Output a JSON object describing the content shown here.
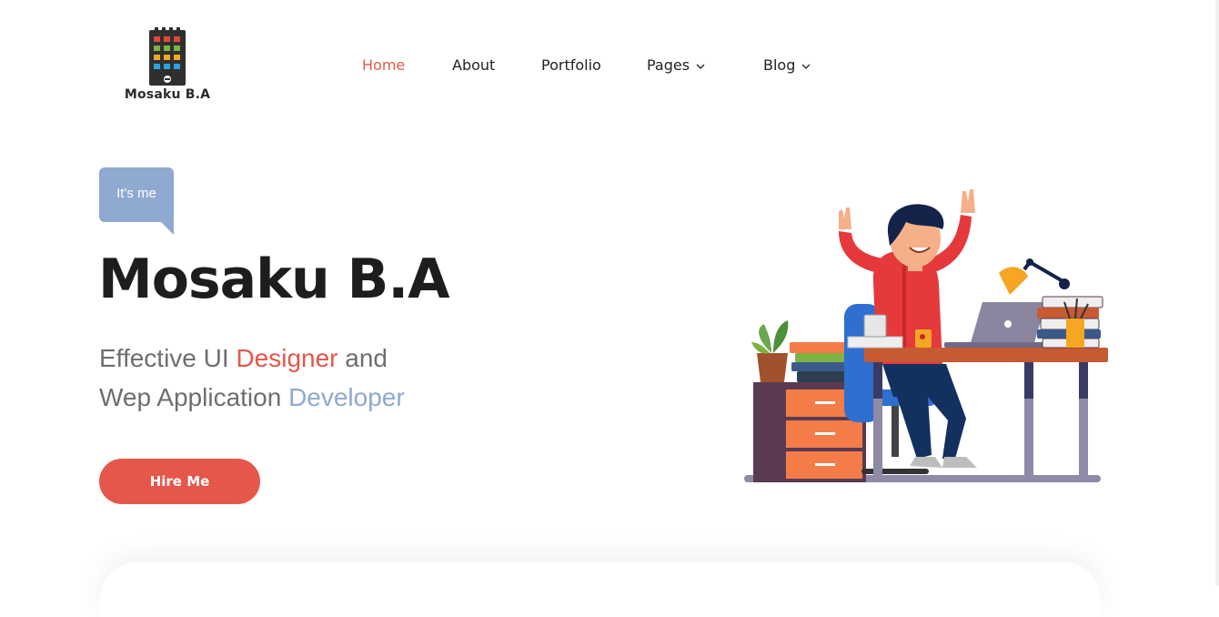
{
  "brand": {
    "name": "Mosaku B.A",
    "icon": "building-logo-icon"
  },
  "nav": {
    "items": [
      {
        "label": "Home",
        "active": true
      },
      {
        "label": "About",
        "active": false
      },
      {
        "label": "Portfolio",
        "active": false
      },
      {
        "label": "Pages",
        "active": false,
        "dropdown": true
      },
      {
        "label": "Blog",
        "active": false,
        "dropdown": true
      }
    ]
  },
  "hero": {
    "badge": "It's me",
    "title": "Mosaku B.A",
    "line1_pre": "Effective UI ",
    "line1_highlight": "Designer",
    "line1_post": " and",
    "line2_pre": "Wep Application ",
    "line2_highlight": "Developer",
    "cta_label": "Hire Me"
  },
  "colors": {
    "accent_red": "#e5574a",
    "accent_blue": "#8fa9d0",
    "text_dark": "#1d1d1d",
    "text_muted": "#6e6e6e"
  }
}
